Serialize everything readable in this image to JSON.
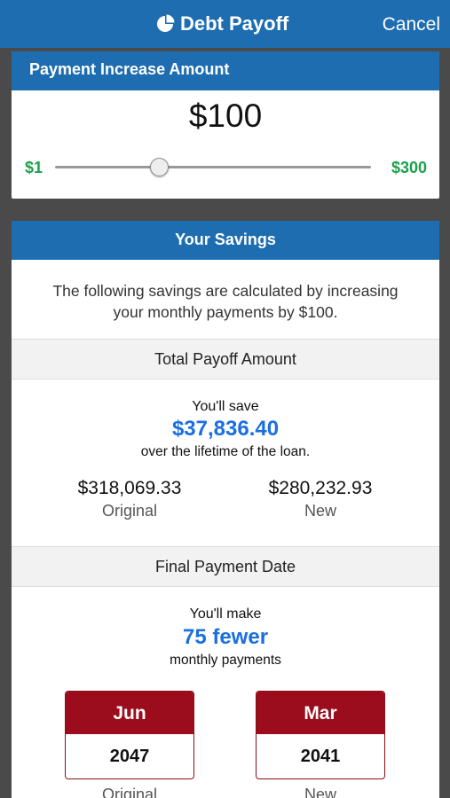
{
  "header": {
    "title": "Debt Payoff",
    "cancel_label": "Cancel",
    "icon": "pie-chart-icon"
  },
  "increase": {
    "title": "Payment Increase Amount",
    "amount": "$100",
    "min_label": "$1",
    "max_label": "$300",
    "slider_fraction": 0.33
  },
  "savings": {
    "title": "Your Savings",
    "intro": "The following savings are calculated by increasing your monthly payments by $100.",
    "total": {
      "section_title": "Total Payoff Amount",
      "lead": "You'll save",
      "amount": "$37,836.40",
      "trail": "over the lifetime of the loan.",
      "original_value": "$318,069.33",
      "original_label": "Original",
      "new_value": "$280,232.93",
      "new_label": "New"
    },
    "final": {
      "section_title": "Final Payment Date",
      "lead": "You'll make",
      "amount": "75 fewer",
      "trail": "monthly payments",
      "original_month": "Jun",
      "original_year": "2047",
      "original_label": "Original",
      "new_month": "Mar",
      "new_year": "2041",
      "new_label": "New"
    }
  },
  "colors": {
    "nav": "#1e6db0",
    "accent_green": "#1aa14a",
    "accent_blue": "#1a6fe0",
    "calendar_red": "#9b0d1c"
  }
}
